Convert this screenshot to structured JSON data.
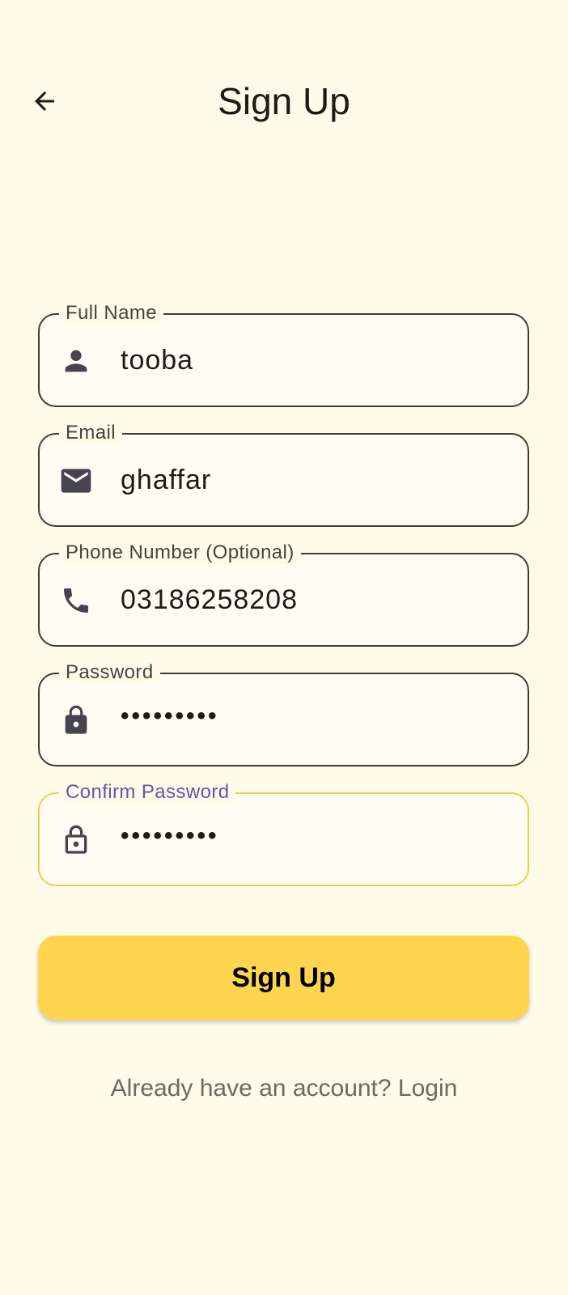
{
  "status_bar": {
    "left_text": "",
    "right_text": ""
  },
  "app_bar": {
    "title": "Sign Up",
    "back_icon": "arrow-left-icon"
  },
  "form": {
    "fields": [
      {
        "label": "Full Name",
        "value": "tooba",
        "icon": "person-icon"
      },
      {
        "label": "Email",
        "value": "ghaffar",
        "icon": "mail-icon"
      },
      {
        "label": "Phone Number (Optional)",
        "value": "03186258208",
        "icon": "phone-icon"
      },
      {
        "label": "Password",
        "value": "•••••••••",
        "icon": "lock-filled-icon"
      },
      {
        "label": "Confirm Password",
        "value": "•••••••••",
        "icon": "lock-outline-icon",
        "focused": true
      }
    ],
    "submit_label": "Sign Up"
  },
  "footer": {
    "login_prompt": "Already have an account? Login"
  },
  "colors": {
    "background": "#fffbe9",
    "accent": "#ffd54f",
    "focus_border": "#f3cc4a",
    "focus_label": "#6a54a6",
    "border": "#3f3c36"
  }
}
